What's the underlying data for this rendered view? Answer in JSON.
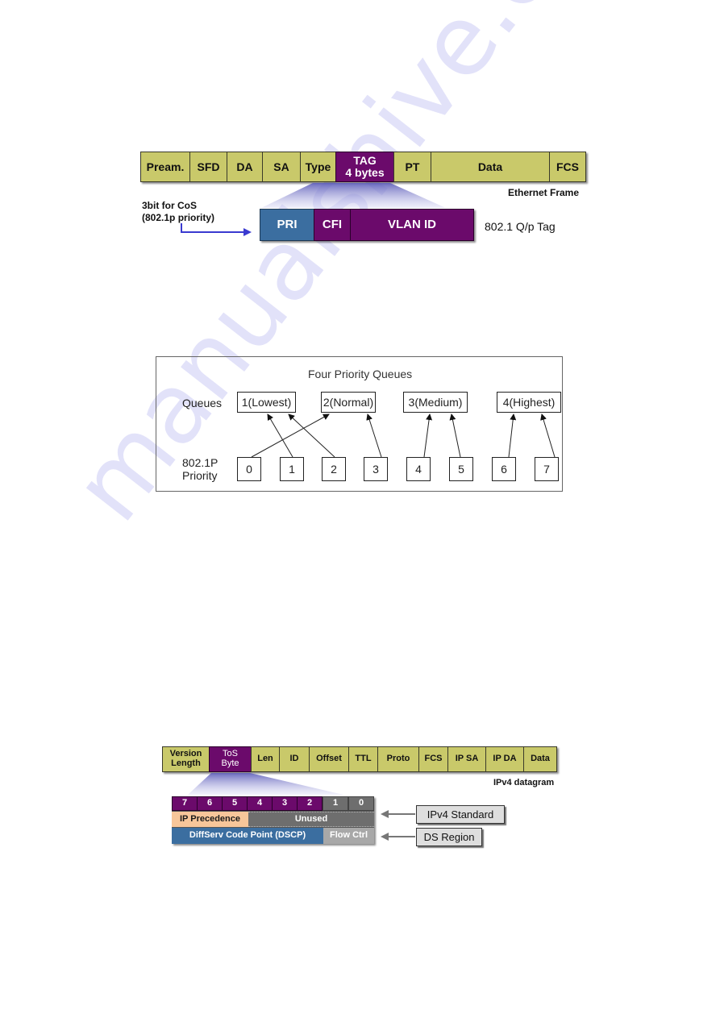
{
  "watermark": "manualshive.com",
  "ethernet_frame": {
    "fields": [
      "Pream.",
      "SFD",
      "DA",
      "SA",
      "Type",
      "TAG\n4 bytes",
      "PT",
      "Data",
      "FCS"
    ],
    "tag_line1": "TAG",
    "tag_line2": "4 bytes",
    "caption": "Ethernet Frame",
    "cos_label_line1": "3bit for CoS",
    "cos_label_line2": "(802.1p priority)",
    "tag_fields": [
      "PRI",
      "CFI",
      "VLAN ID"
    ],
    "tag_caption": "802.1 Q/p Tag",
    "colors": {
      "field": "#c9c96a",
      "tag": "#6b0a6b",
      "pri": "#3b6ea0",
      "arrow": "#3a3ad0"
    }
  },
  "priority_queues": {
    "title": "Four Priority Queues",
    "queues_label": "Queues",
    "priority_label_line1": "802.1P",
    "priority_label_line2": "Priority",
    "queues": [
      "1(Lowest)",
      "2(Normal)",
      "3(Medium)",
      "4(Highest)"
    ],
    "priorities": [
      "0",
      "1",
      "2",
      "3",
      "4",
      "5",
      "6",
      "7"
    ],
    "mapping": [
      {
        "priority": "0",
        "queue": "2(Normal)"
      },
      {
        "priority": "1",
        "queue": "1(Lowest)"
      },
      {
        "priority": "2",
        "queue": "1(Lowest)"
      },
      {
        "priority": "3",
        "queue": "2(Normal)"
      },
      {
        "priority": "4",
        "queue": "3(Medium)"
      },
      {
        "priority": "5",
        "queue": "3(Medium)"
      },
      {
        "priority": "6",
        "queue": "4(Highest)"
      },
      {
        "priority": "7",
        "queue": "4(Highest)"
      }
    ]
  },
  "ipv4_datagram": {
    "fields": [
      "Version\nLength",
      "ToS\nByte",
      "Len",
      "ID",
      "Offset",
      "TTL",
      "Proto",
      "FCS",
      "IP SA",
      "IP DA",
      "Data"
    ],
    "version_line1": "Version",
    "version_line2": "Length",
    "tos_line1": "ToS",
    "tos_line2": "Byte",
    "caption": "IPv4 datagram",
    "bits": [
      "7",
      "6",
      "5",
      "4",
      "3",
      "2",
      "1",
      "0"
    ],
    "ip_precedence": "IP Precedence",
    "unused": "Unused",
    "dscp": "DiffServ Code Point (DSCP)",
    "flow_ctrl": "Flow Ctrl",
    "callouts": [
      "IPv4 Standard",
      "DS Region"
    ]
  }
}
